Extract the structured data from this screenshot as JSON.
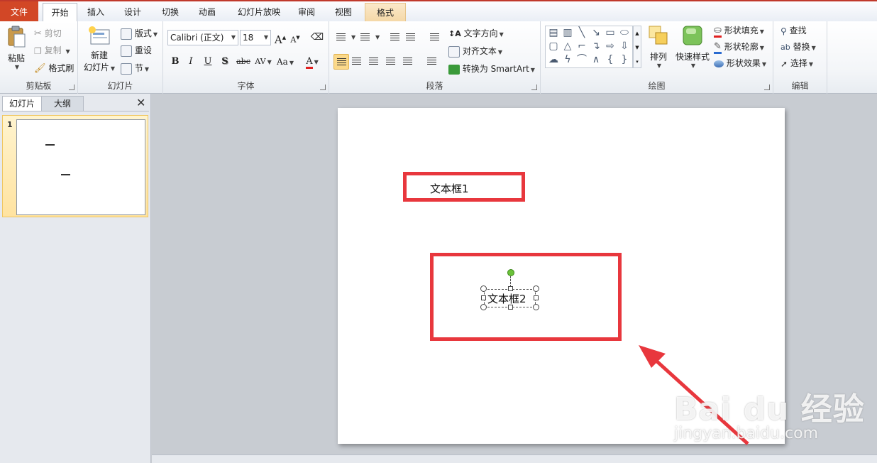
{
  "tabs": {
    "file": "文件",
    "home": "开始",
    "insert": "插入",
    "design": "设计",
    "transitions": "切换",
    "animations": "动画",
    "slideshow": "幻灯片放映",
    "review": "审阅",
    "view": "视图",
    "format": "格式"
  },
  "clipboard": {
    "paste": "粘贴",
    "cut": "剪切",
    "copy": "复制",
    "format_painter": "格式刷",
    "label": "剪贴板"
  },
  "slides_group": {
    "new_slide_1": "新建",
    "new_slide_2": "幻灯片",
    "layout": "版式",
    "reset": "重设",
    "section": "节",
    "label": "幻灯片"
  },
  "font": {
    "name": "Calibri (正文)",
    "size": "18",
    "bold": "B",
    "italic": "I",
    "underline": "U",
    "shadow": "S",
    "strikethrough": "abc",
    "spacing": "AV",
    "change_case": "Aa",
    "grow": "A",
    "shrink": "A",
    "color_letter": "A",
    "label": "字体"
  },
  "paragraph": {
    "text_direction": "文字方向",
    "align_text": "对齐文本",
    "convert_smartart": "转换为 SmartArt",
    "label": "段落"
  },
  "drawing": {
    "arrange": "排列",
    "quick_styles": "快速样式",
    "shape_fill": "形状填充",
    "shape_outline": "形状轮廓",
    "shape_effects": "形状效果",
    "label": "绘图"
  },
  "editing": {
    "find": "查找",
    "replace": "替换",
    "select": "选择",
    "label": "编辑"
  },
  "left_pane": {
    "tab_slides": "幻灯片",
    "tab_outline": "大纲",
    "close": "✕",
    "slide_number": "1"
  },
  "slide": {
    "textbox1": "文本框1",
    "textbox2": "文本框2"
  },
  "watermark": {
    "brand": "Bai du 经验",
    "url": "jingyan.baidu.com"
  },
  "colors": {
    "accent_red": "#e8373d",
    "file_tab": "#d24726",
    "selection": "#fbd98a"
  }
}
